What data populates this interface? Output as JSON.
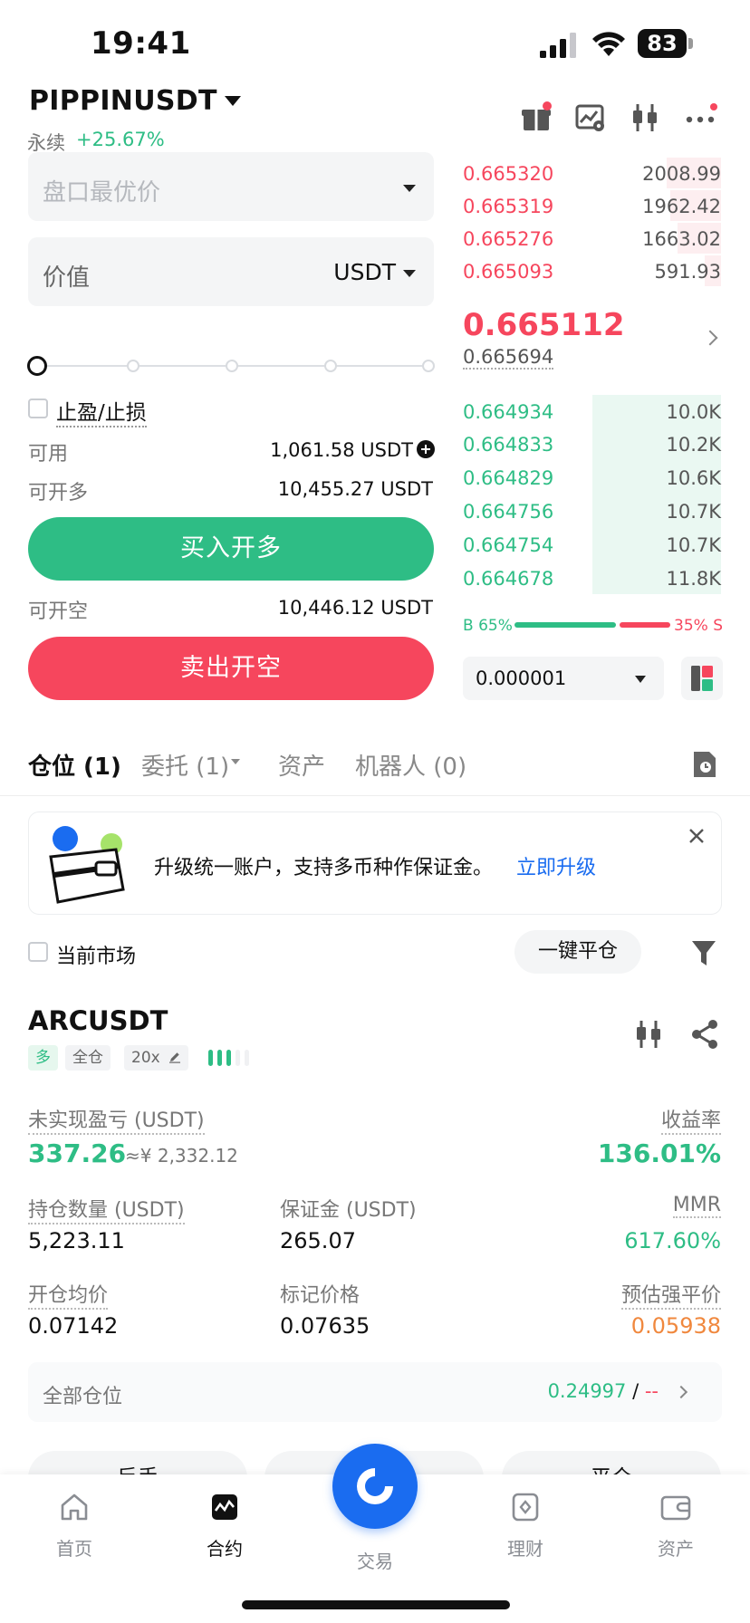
{
  "status_bar": {
    "time": "19:41",
    "battery": "83"
  },
  "header": {
    "pair": "PIPPINUSDT",
    "type": "永续",
    "change": "+25.67%"
  },
  "order_form": {
    "price_placeholder": "盘口最优价",
    "value_label": "价值",
    "value_unit": "USDT",
    "tpsl_label": "止盈/止损",
    "available_label": "可用",
    "available_value": "1,061.58 USDT",
    "max_long_label": "可开多",
    "max_long_value": "10,455.27 USDT",
    "buy_label": "买入开多",
    "max_short_label": "可开空",
    "max_short_value": "10,446.12 USDT",
    "sell_label": "卖出开空"
  },
  "order_book": {
    "asks": [
      {
        "price": "0.665320",
        "qty": "2008.99"
      },
      {
        "price": "0.665319",
        "qty": "1962.42"
      },
      {
        "price": "0.665276",
        "qty": "1663.02"
      },
      {
        "price": "0.665093",
        "qty": "591.93"
      }
    ],
    "last_price": "0.665112",
    "mark_price": "0.665694",
    "bids": [
      {
        "price": "0.664934",
        "qty": "10.0K"
      },
      {
        "price": "0.664833",
        "qty": "10.2K"
      },
      {
        "price": "0.664829",
        "qty": "10.6K"
      },
      {
        "price": "0.664756",
        "qty": "10.7K"
      },
      {
        "price": "0.664754",
        "qty": "10.7K"
      },
      {
        "price": "0.664678",
        "qty": "11.8K"
      }
    ],
    "buy_ratio_label": "B 65%",
    "sell_ratio_label": "35% S",
    "buy_ratio": 0.65,
    "precision": "0.000001"
  },
  "tabs": {
    "positions": "仓位 (1)",
    "orders": "委托 (1)",
    "assets": "资产",
    "bots": "机器人 (0)"
  },
  "banner": {
    "text": "升级统一账户，支持多币种作保证金。",
    "link": "立即升级"
  },
  "filter": {
    "current_market": "当前市场",
    "close_all": "一键平仓"
  },
  "position": {
    "symbol": "ARCUSDT",
    "side": "多",
    "margin_mode": "全仓",
    "leverage": "20x",
    "upnl_label": "未实现盈亏 (USDT)",
    "upnl_value": "337.26",
    "upnl_cny": "≈¥ 2,332.12",
    "roe_label": "收益率",
    "roe_value": "136.01%",
    "size_label": "持仓数量 (USDT)",
    "size_value": "5,223.11",
    "margin_label": "保证金 (USDT)",
    "margin_value": "265.07",
    "mmr_label": "MMR",
    "mmr_value": "617.60%",
    "entry_label": "开仓均价",
    "entry_value": "0.07142",
    "markp_label": "标记价格",
    "markp_value": "0.07635",
    "liq_label": "预估强平价",
    "liq_value": "0.05938",
    "all_positions_label": "全部仓位",
    "all_positions_value": "0.24997",
    "all_positions_sep": " / ",
    "all_positions_dash": "--",
    "action_reverse": "反手",
    "action_close": "平仓"
  },
  "nav": {
    "home": "首页",
    "contract": "合约",
    "trade": "交易",
    "finance": "理财",
    "assets": "资产"
  },
  "colors": {
    "green": "#2ebd85",
    "red": "#f6465d",
    "blue": "#1a6cf0",
    "orange": "#f0883e"
  }
}
